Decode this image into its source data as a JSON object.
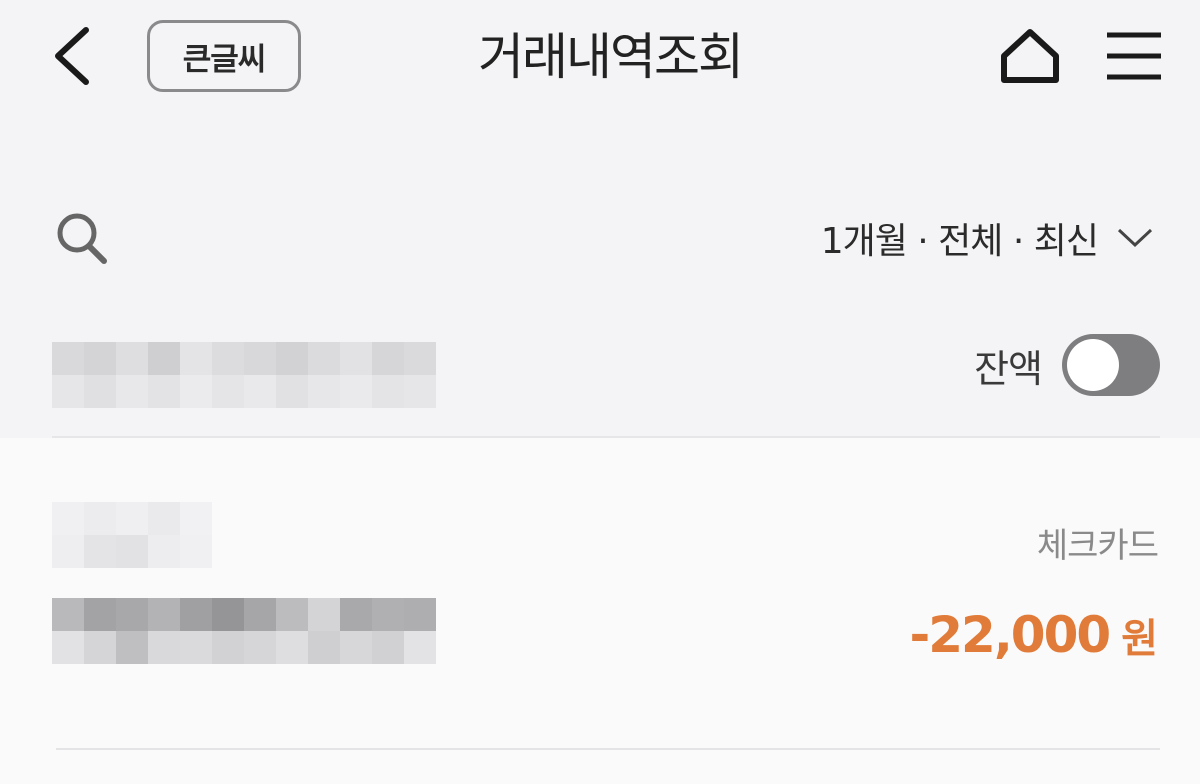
{
  "header": {
    "back_icon": "chevron-left-icon",
    "font_size_label": "큰글씨",
    "title": "거래내역조회",
    "home_icon": "home-icon",
    "menu_icon": "hamburger-menu-icon"
  },
  "filter": {
    "search_icon": "search-icon",
    "summary": "1개월 · 전체 · 최신",
    "chevron_icon": "chevron-down-icon"
  },
  "account": {
    "balance_label": "잔액",
    "balance_toggle_on": false
  },
  "transactions": [
    {
      "type": "체크카드",
      "amount": "-22,000",
      "unit": "원",
      "amount_color": "#e07b39"
    }
  ],
  "colors": {
    "background": "#f4f4f6",
    "list_background": "#fafafa",
    "accent_negative": "#e07b39",
    "toggle_off": "#7e7e80"
  }
}
